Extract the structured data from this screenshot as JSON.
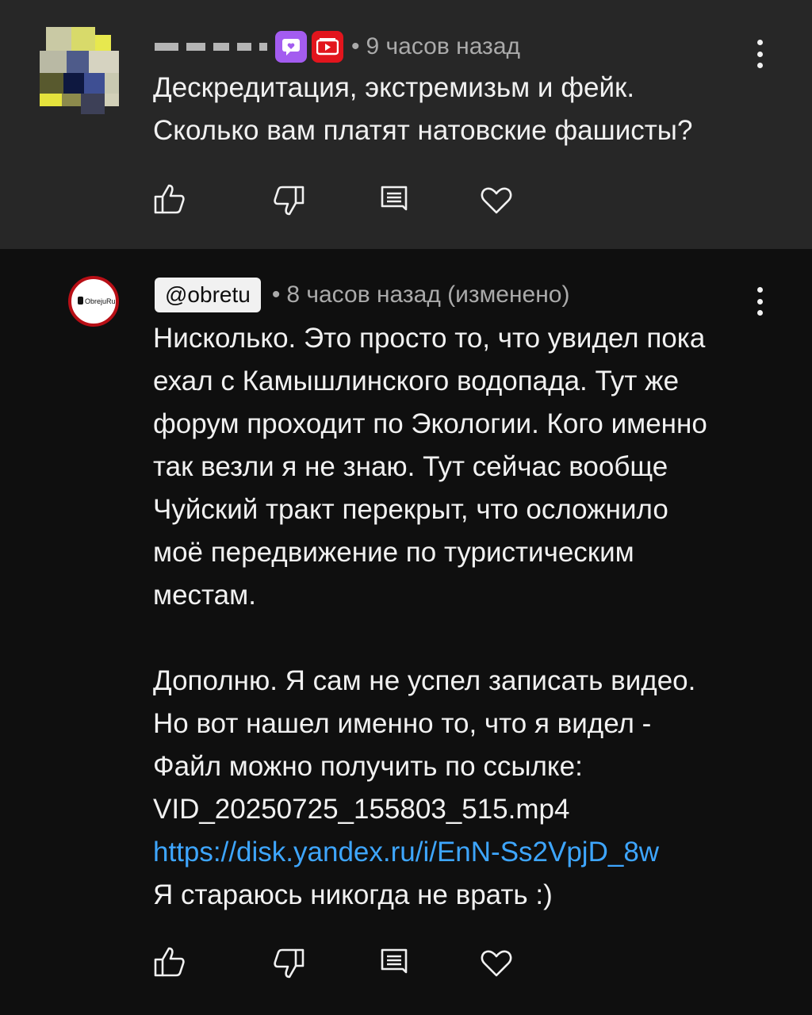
{
  "comments": [
    {
      "author_handle": "",
      "timestamp": "9 часов назад",
      "lines": [
        "Дескредитация, экстремизьм и фейк.",
        "Сколько вам платят натовские фашисты?"
      ],
      "badges": [
        "purple-heart-chat-badge",
        "red-youtube-badge"
      ],
      "avatar": "pixelated-avatar"
    },
    {
      "author_handle": "@obretu",
      "timestamp": "8 часов назад (изменено)",
      "avatar_text": "ObrejuRu",
      "lines": [
        "Нисколько. Это просто то, что увидел пока",
        "ехал с Камышлинского водопада. Тут же",
        "форум проходит по Экологии. Кого именно",
        "так везли я не знаю. Тут сейчас вообще",
        "Чуйский тракт перекрыт, что осложнило",
        "моё передвижение по туристическим",
        "местам.",
        "",
        "Дополню. Я сам не успел записать видео.",
        "Но вот нашел именно то, что я видел -",
        "Файл можно получить по ссылке:",
        "VID_20250725_155803_515.mp4"
      ],
      "link": "https://disk.yandex.ru/i/EnN-Ss2VpjD_8w",
      "last_line": "Я стараюсь никогда не врать :)"
    }
  ],
  "action_icons": [
    "like-icon",
    "dislike-icon",
    "reply-icon",
    "heart-icon"
  ],
  "colors": {
    "top_comment_bg": "#272727",
    "page_bg": "#0f0f0f",
    "text": "#f1f1f1",
    "meta": "#aaaaaa",
    "link": "#3ea6ff"
  }
}
